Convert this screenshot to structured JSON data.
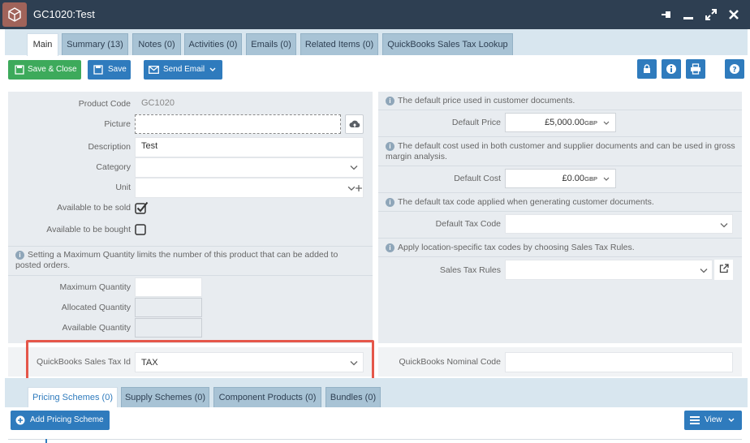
{
  "window": {
    "title": "GC1020:Test",
    "icons": [
      "box-icon",
      "pin-icon",
      "minimize-icon",
      "expand-icon",
      "close-icon"
    ]
  },
  "tabs": [
    {
      "label": "Main"
    },
    {
      "label": "Summary (13)"
    },
    {
      "label": "Notes (0)"
    },
    {
      "label": "Activities (0)"
    },
    {
      "label": "Emails (0)"
    },
    {
      "label": "Related Items (0)"
    },
    {
      "label": "QuickBooks Sales Tax Lookup"
    }
  ],
  "toolbar": {
    "save_close": "Save & Close",
    "save": "Save",
    "send_email": "Send Email",
    "right_icons": [
      "lock-icon",
      "info-icon",
      "print-icon",
      "help-icon"
    ]
  },
  "left": {
    "product_code_label": "Product Code",
    "product_code_value": "GC1020",
    "picture_label": "Picture",
    "description_label": "Description",
    "description_value": "Test",
    "category_label": "Category",
    "unit_label": "Unit",
    "available_sold_label": "Available to be sold",
    "available_sold_checked": true,
    "available_bought_label": "Available to be bought",
    "available_bought_checked": false,
    "max_qty_info": "Setting a Maximum Quantity limits the number of this product that can be added to posted orders.",
    "max_qty_label": "Maximum Quantity",
    "allocated_qty_label": "Allocated Quantity",
    "available_qty_label": "Available Quantity",
    "qb_tax_label": "QuickBooks Sales Tax Id",
    "qb_tax_value": "TAX"
  },
  "right": {
    "default_price_info": "The default price used in customer documents.",
    "default_price_label": "Default Price",
    "default_price_value": "£5,000.00",
    "default_price_currency": "GBP",
    "default_cost_info": "The default cost used in both customer and supplier documents and can be used in gross margin analysis.",
    "default_cost_label": "Default Cost",
    "default_cost_value": "£0.00",
    "default_cost_currency": "GBP",
    "tax_code_info": "The default tax code applied when generating customer documents.",
    "tax_code_label": "Default Tax Code",
    "sales_tax_info": "Apply location-specific tax codes by choosing Sales Tax Rules.",
    "sales_tax_label": "Sales Tax Rules",
    "nominal_code_label": "QuickBooks Nominal Code"
  },
  "bottom_tabs": [
    {
      "label": "Pricing Schemes (0)"
    },
    {
      "label": "Supply Schemes (0)"
    },
    {
      "label": "Component Products (0)"
    },
    {
      "label": "Bundles (0)"
    }
  ],
  "bottom": {
    "add_pricing": "Add Pricing Scheme",
    "view": "View"
  },
  "colors": {
    "titlebar": "#2e3f52",
    "accent_blue": "#2f7bbd",
    "save_green": "#3daa5b",
    "highlight_red": "#e5574a"
  }
}
